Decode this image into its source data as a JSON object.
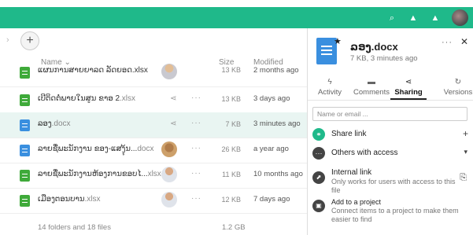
{
  "header": {
    "search_glyph": "⌕",
    "bell_glyph": "▲",
    "contacts_glyph": "▲",
    "accent": "#1fb98a"
  },
  "toolbar": {
    "new_glyph": "+",
    "chevron_glyph": "›"
  },
  "columns": {
    "name": "Name",
    "sort_glyph": "⌄",
    "size": "Size",
    "modified": "Modified"
  },
  "files": [
    {
      "name": "ແຜນການສາຍຍາລດ ລັດຍອດ.xlsx",
      "ext": "",
      "type": "xlsx",
      "size": "13 KB",
      "modified": "2 months ago",
      "owner": "p1",
      "shared": false,
      "cut": true
    },
    {
      "name": "ເບີຕິດຕໍ່ພາຍໃນສູນ ຂາອ 2",
      "ext": ".xlsx",
      "type": "xlsx",
      "size": "13 KB",
      "modified": "3 days ago",
      "owner": "",
      "shared": true
    },
    {
      "name": "ລອງ",
      "ext": ".docx",
      "type": "docx",
      "size": "7 KB",
      "modified": "3 minutes ago",
      "owner": "",
      "shared": true,
      "selected": true
    },
    {
      "name": "ລາຍຊື່ພະນັກງານ ຂອງ-ແສງຸ້ນ...",
      "ext": "docx",
      "type": "docx",
      "size": "26 KB",
      "modified": "a year ago",
      "owner": "p2",
      "shared": false
    },
    {
      "name": "ລາຍຊື່ພະນັກງານຫ້ອງການຂອບໄ...",
      "ext": "xlsx",
      "type": "xlsx",
      "size": "11 KB",
      "modified": "10 months ago",
      "owner": "p3",
      "shared": false
    },
    {
      "name": "ເມືອງຕອນບານ",
      "ext": ".xlsx",
      "type": "xlsx",
      "size": "12 KB",
      "modified": "7 days ago",
      "owner": "p4",
      "shared": false
    }
  ],
  "glyphs": {
    "share": "⋖",
    "more": "···"
  },
  "footer": {
    "count": "14 folders and 18 files",
    "total": "1.2 GB"
  },
  "sidebar": {
    "file_name": "ລອງ.docx",
    "file_meta": "7 KB, 3 minutes ago",
    "star_glyph": "★",
    "more_glyph": "···",
    "close_glyph": "✕",
    "tabs": [
      {
        "icon": "ϟ",
        "label": "Activity"
      },
      {
        "icon": "▬",
        "label": "Comments"
      },
      {
        "icon": "⋖",
        "label": "Sharing"
      },
      {
        "icon": "↻",
        "label": "Versions"
      }
    ],
    "search_placeholder": "Name or email ...",
    "share_link": {
      "label": "Share link",
      "action": "+"
    },
    "others": {
      "label": "Others with access",
      "action": "▾"
    },
    "internal": {
      "label": "Internal link",
      "desc": "Only works for users with access to this file",
      "action": "⎘"
    },
    "project": {
      "label": "Add to a project",
      "desc": "Connect items to a project to make them easier to find"
    }
  }
}
